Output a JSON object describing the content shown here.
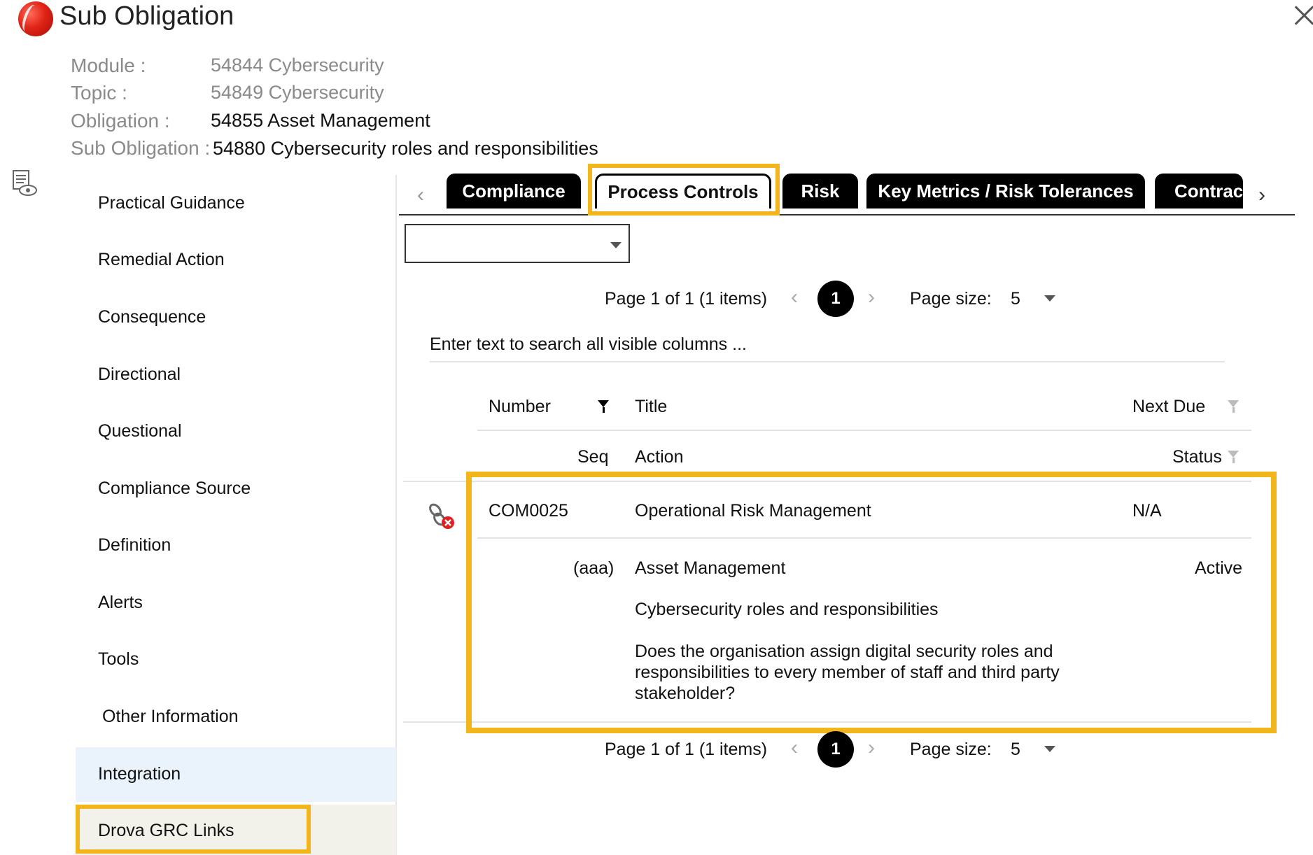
{
  "window": {
    "title": "Sub Obligation"
  },
  "meta": [
    {
      "label": "Module :",
      "value": "54844 Cybersecurity"
    },
    {
      "label": "Topic :",
      "value": "54849 Cybersecurity"
    },
    {
      "label": "Obligation :",
      "value": "54855 Asset Management"
    },
    {
      "label": "Sub Obligation :",
      "value": "54880 Cybersecurity roles and responsibilities"
    }
  ],
  "sidebar": {
    "items": [
      {
        "label": "Practical Guidance"
      },
      {
        "label": "Remedial Action"
      },
      {
        "label": "Consequence"
      },
      {
        "label": "Directional"
      },
      {
        "label": "Questional"
      },
      {
        "label": "Compliance Source"
      },
      {
        "label": "Definition"
      },
      {
        "label": "Alerts"
      },
      {
        "label": "Tools"
      },
      {
        "label": "Other Information"
      },
      {
        "label": "Integration"
      },
      {
        "label": "Drova GRC Links"
      }
    ]
  },
  "tabs": [
    {
      "label": "Compliance"
    },
    {
      "label": "Process Controls"
    },
    {
      "label": "Risk"
    },
    {
      "label": "Key Metrics / Risk Tolerances"
    },
    {
      "label": "Contract"
    }
  ],
  "pager": {
    "summary": "Page 1 of 1 (1 items)",
    "current_page": "1",
    "page_size_label": "Page size:",
    "page_size": "5"
  },
  "search": {
    "placeholder": "Enter text to search all visible columns ..."
  },
  "grid": {
    "headers": {
      "number": "Number",
      "title": "Title",
      "next_due": "Next Due",
      "seq": "Seq",
      "action": "Action",
      "status": "Status"
    },
    "row": {
      "number": "COM0025",
      "title": "Operational Risk Management",
      "next_due": "N/A",
      "seq": "(aaa)",
      "action": "Asset Management",
      "status": "Active",
      "line2": "Cybersecurity roles and responsibilities",
      "line3a": "Does the organisation assign digital security roles and",
      "line3b": "responsibilities to every member of staff and third party",
      "line3c": "stakeholder?"
    }
  },
  "colors": {
    "highlight": "#f2b51c",
    "tab_bg": "#000000",
    "integration_bg": "#eaf3fc"
  }
}
